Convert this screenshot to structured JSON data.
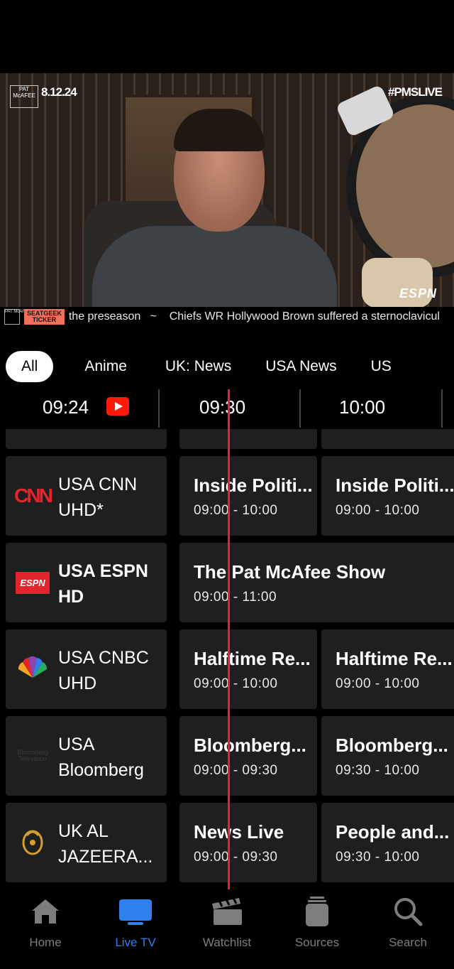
{
  "player": {
    "logo_text": "PAT McAFEE",
    "date": "8.12.24",
    "hashtag": "#PMSLIVE",
    "network_logo": "ESPN",
    "ticker": {
      "logo_text": "PAT McAFEE",
      "badge_line1": "SEATGEEK",
      "badge_line2": "TICKER",
      "text": "the preseason   ~    Chiefs WR Hollywood Brown suffered a sternoclavicul"
    }
  },
  "filters": {
    "chips": [
      "All",
      "Anime",
      "UK: News",
      "USA News",
      "US"
    ],
    "active": "All"
  },
  "timeline": {
    "current_time": "09:24",
    "slots": [
      "09:30",
      "10:00"
    ],
    "now_icon": "youtube-play-icon"
  },
  "guide": {
    "partial_top_label": "",
    "channels": [
      {
        "logo": "CNN",
        "name_line1": "USA CNN",
        "name_line2": "UHD*",
        "bold": false,
        "programs": [
          {
            "title": "Inside Politi...",
            "time": "09:00 - 10:00"
          },
          {
            "title": "Inside Politi...",
            "time": "09:00 - 10:00"
          }
        ]
      },
      {
        "logo": "ESPN",
        "name_line1": "USA ESPN",
        "name_line2": "HD",
        "bold": true,
        "programs": [
          {
            "title": "The Pat McAfee Show",
            "time": "09:00 - 11:00"
          }
        ]
      },
      {
        "logo": "CNBC",
        "name_line1": "USA CNBC",
        "name_line2": "UHD",
        "bold": false,
        "programs": [
          {
            "title": "Halftime Re...",
            "time": "09:00 - 10:00"
          },
          {
            "title": "Halftime Re...",
            "time": "09:00 - 10:00"
          }
        ]
      },
      {
        "logo": "Bloomberg Television",
        "name_line1": "USA",
        "name_line2": "Bloomberg",
        "bold": false,
        "programs": [
          {
            "title": "Bloomberg...",
            "time": "09:00 - 09:30"
          },
          {
            "title": "Bloomberg...",
            "time": "09:30 - 10:00"
          }
        ]
      },
      {
        "logo": "Al Jazeera",
        "name_line1": "UK AL",
        "name_line2": "JAZEERA...",
        "bold": false,
        "programs": [
          {
            "title": "News Live",
            "time": "09:00 - 09:30"
          },
          {
            "title": "People and...",
            "time": "09:30 - 10:00"
          }
        ]
      }
    ]
  },
  "tabbar": {
    "items": [
      {
        "label": "Home",
        "icon": "home-icon"
      },
      {
        "label": "Live TV",
        "icon": "tv-icon"
      },
      {
        "label": "Watchlist",
        "icon": "clapperboard-icon"
      },
      {
        "label": "Sources",
        "icon": "sources-icon"
      },
      {
        "label": "Search",
        "icon": "search-icon"
      }
    ],
    "active": "Live TV"
  },
  "colors": {
    "accent": "#2f80ed",
    "now_line": "#e3262d",
    "cell_bg": "#1f1f1f",
    "youtube": "#ff1a0a"
  }
}
